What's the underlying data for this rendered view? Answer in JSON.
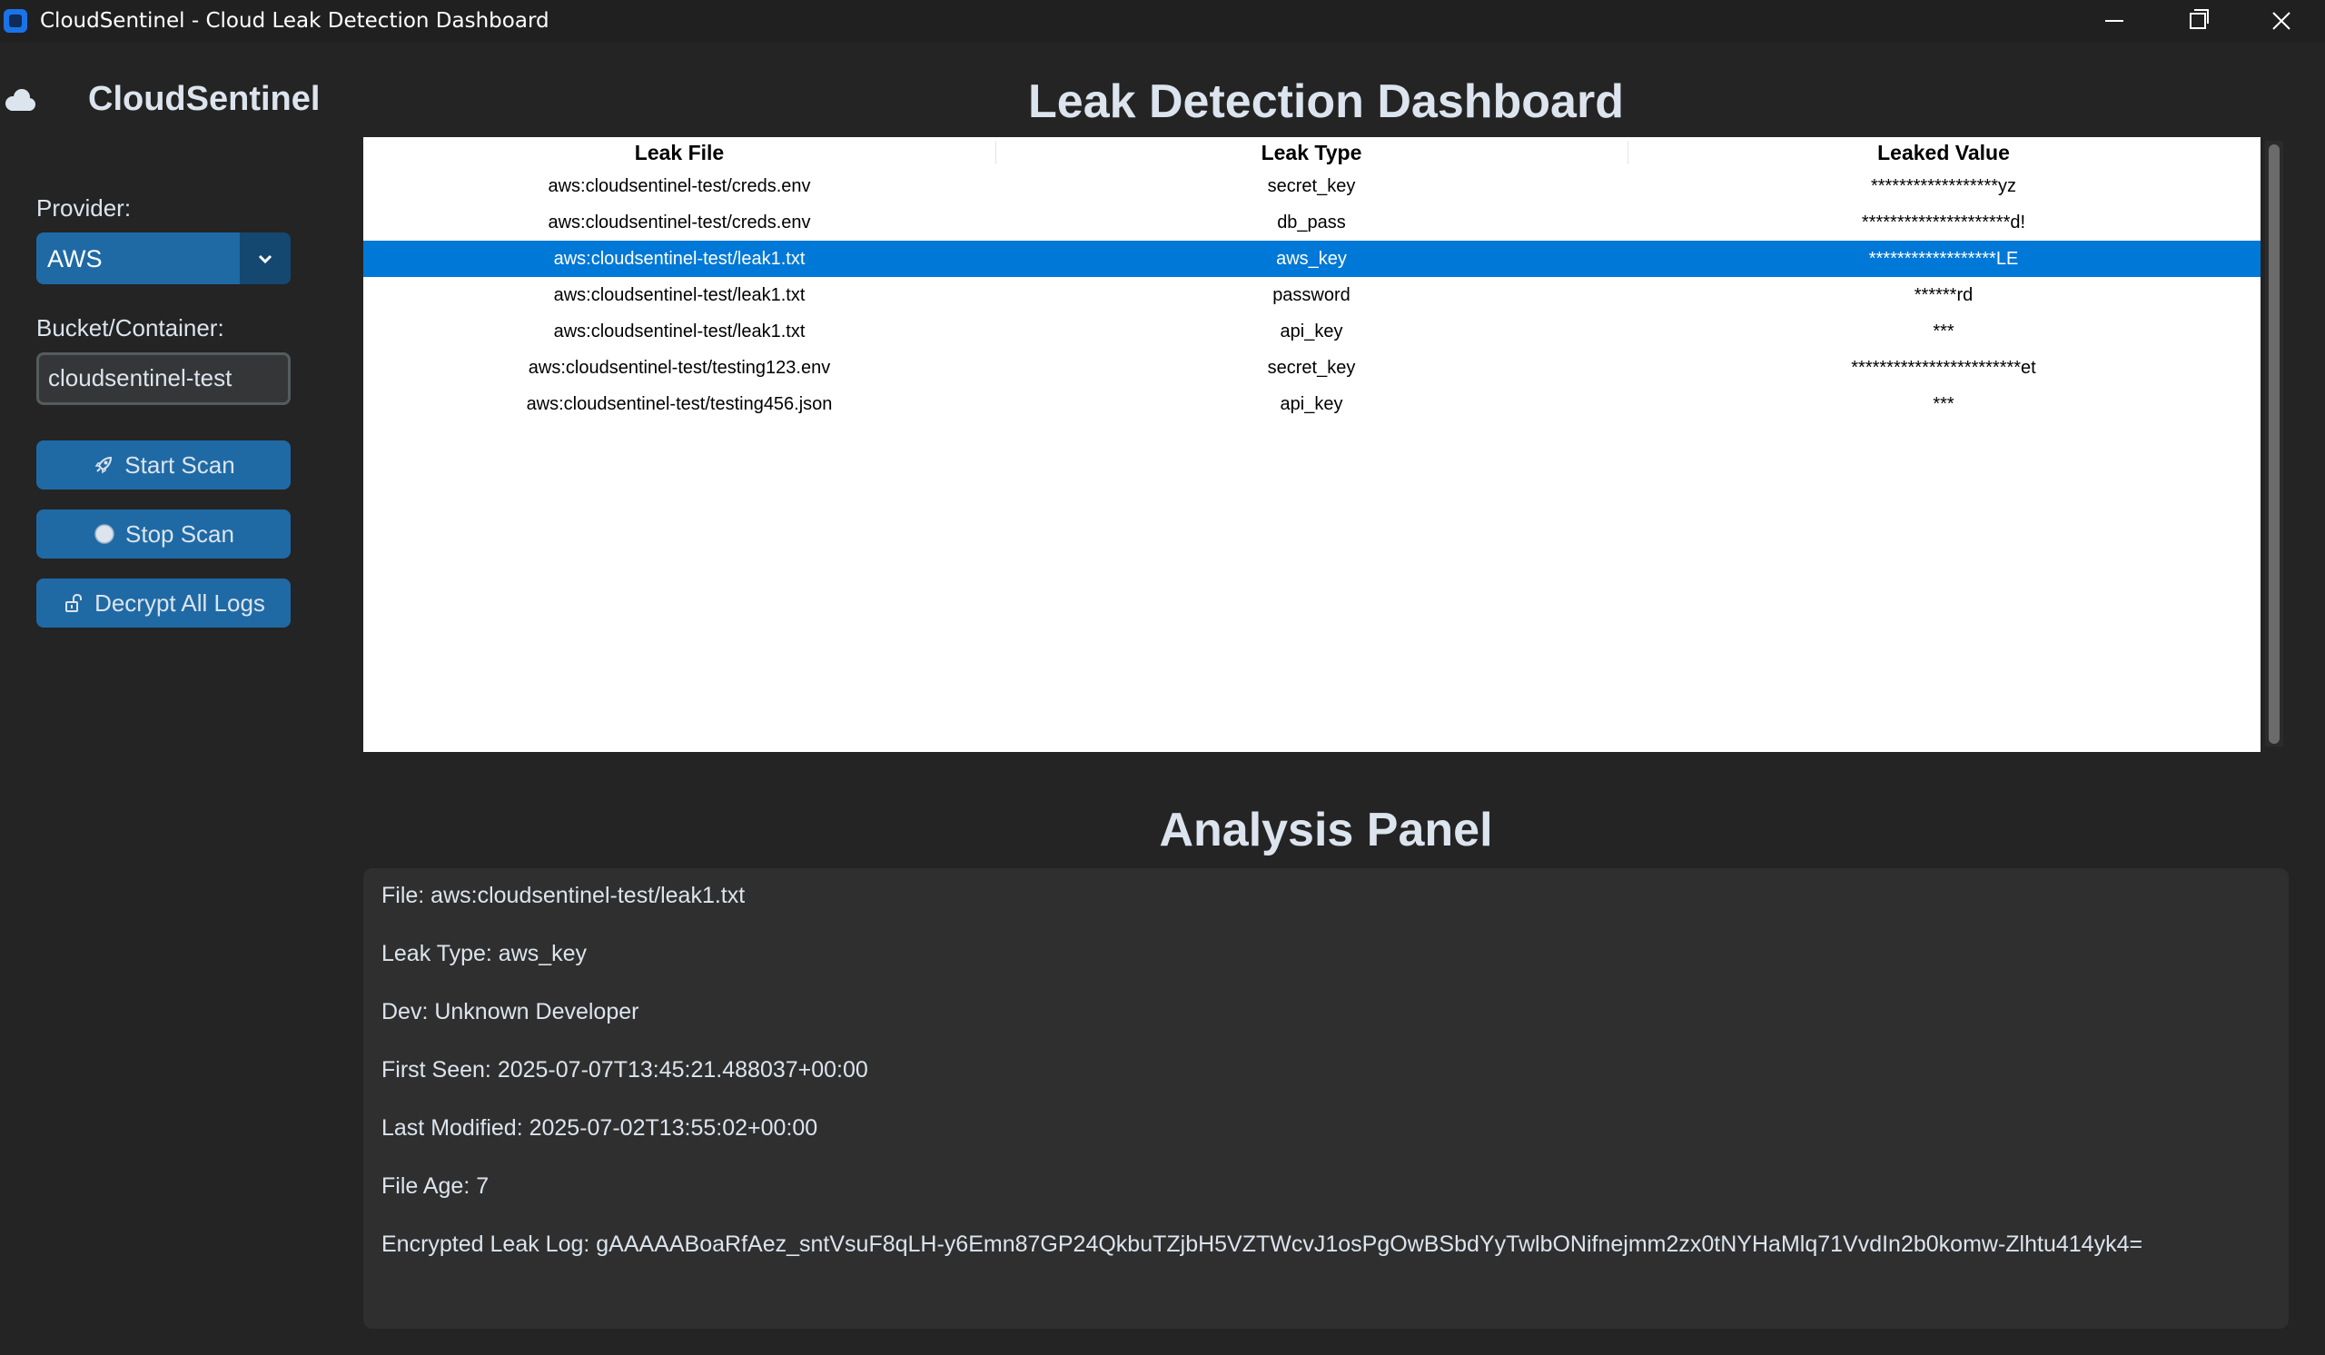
{
  "window": {
    "title": "CloudSentinel - Cloud Leak Detection Dashboard"
  },
  "sidebar": {
    "brand": "CloudSentinel",
    "provider_label": "Provider:",
    "provider_value": "AWS",
    "bucket_label": "Bucket/Container:",
    "bucket_value": "cloudsentinel-test",
    "buttons": {
      "start": "Start Scan",
      "stop": "Stop Scan",
      "decrypt": "Decrypt All Logs"
    }
  },
  "main": {
    "title": "Leak Detection Dashboard",
    "table": {
      "columns": [
        "Leak File",
        "Leak Type",
        "Leaked Value"
      ],
      "selected_row": 2,
      "rows": [
        [
          "aws:cloudsentinel-test/creds.env",
          "secret_key",
          "******************yz"
        ],
        [
          "aws:cloudsentinel-test/creds.env",
          "db_pass",
          "*********************d!"
        ],
        [
          "aws:cloudsentinel-test/leak1.txt",
          "aws_key",
          "******************LE"
        ],
        [
          "aws:cloudsentinel-test/leak1.txt",
          "password",
          "******rd"
        ],
        [
          "aws:cloudsentinel-test/leak1.txt",
          "api_key",
          "***"
        ],
        [
          "aws:cloudsentinel-test/testing123.env",
          "secret_key",
          "************************et"
        ],
        [
          "aws:cloudsentinel-test/testing456.json",
          "api_key",
          "***"
        ]
      ]
    },
    "analysis": {
      "title": "Analysis Panel",
      "lines": [
        "File: aws:cloudsentinel-test/leak1.txt",
        "Leak Type: aws_key",
        "Dev: Unknown Developer",
        "First Seen: 2025-07-07T13:45:21.488037+00:00",
        "Last Modified: 2025-07-02T13:55:02+00:00",
        "File Age: 7",
        "Encrypted Leak Log: gAAAAABoaRfAez_sntVsuF8qLH-y6Emn87GP24QkbuTZjbH5VZTWcvJ1osPgOwBSbdYyTwlbONifnejmm2zx0tNYHaMlq71VvdIn2b0komw-Zlhtu414yk4="
      ]
    }
  },
  "colors": {
    "background": "#242424",
    "accent": "#1f6aa5",
    "selection": "#0078d7",
    "panel": "#2f2f2f"
  }
}
